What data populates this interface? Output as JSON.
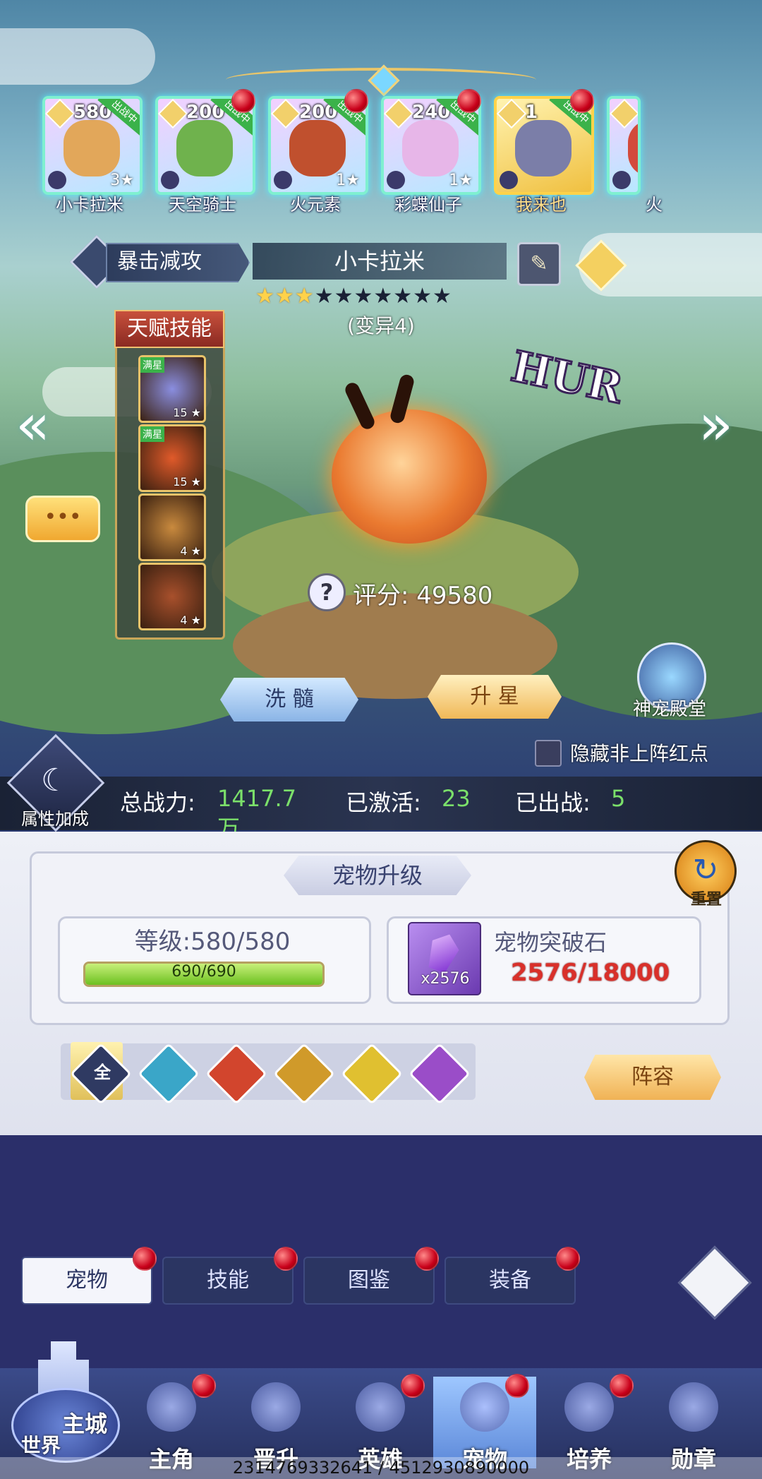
{
  "pets": [
    {
      "name": "小卡拉米",
      "level": "580",
      "status": "出战中",
      "stars": "3",
      "color": "#e2a75a"
    },
    {
      "name": "天空骑士",
      "level": "200",
      "status": "出战中",
      "stars": "",
      "color": "#6fb24d"
    },
    {
      "name": "火元素",
      "level": "200",
      "status": "出战中",
      "stars": "1",
      "color": "#c0502e"
    },
    {
      "name": "彩蝶仙子",
      "level": "240",
      "status": "出战中",
      "stars": "1",
      "color": "#e7b6e8"
    },
    {
      "name": "我来也",
      "level": "1",
      "status": "出战中",
      "stars": "",
      "color": "#7b7ea8"
    },
    {
      "name": "火",
      "level": "",
      "status": "",
      "stars": "",
      "color": "#d34b3c"
    }
  ],
  "header": {
    "skill_label": "暴击减攻",
    "pet_name": "小卡拉米",
    "mutation": "(变异4)",
    "rank": "HUR"
  },
  "talent": {
    "title": "天赋技能",
    "skills": [
      {
        "badge": "满星",
        "level": "15",
        "color": "#8a8ee0"
      },
      {
        "badge": "满星",
        "level": "15",
        "color": "#e05a2a"
      },
      {
        "badge": "",
        "level": "4",
        "color": "#c98a3e"
      },
      {
        "badge": "",
        "level": "4",
        "color": "#a8502c"
      }
    ]
  },
  "score": {
    "label": "评分:",
    "value": "49580"
  },
  "buttons": {
    "wash": "洗 髓",
    "star_up": "升 星",
    "temple": "神宠殿堂",
    "hide_label": "隐藏非上阵红点",
    "attr_bonus": "属性加成"
  },
  "stats": {
    "power_label": "总战力:",
    "power_value": "1417.7",
    "power_unit": "万",
    "active_label": "已激活:",
    "active_value": "23",
    "deployed_label": "已出战:",
    "deployed_value": "5"
  },
  "upgrade": {
    "title": "宠物升级",
    "reset": "重置",
    "level_label": "等级:",
    "level_value": "580/580",
    "exp_text": "690/690",
    "exp_fraction": 1.0,
    "item_name": "宠物突破石",
    "item_count": "x2576",
    "item_progress": "2576/18000"
  },
  "filters": [
    {
      "name": "全",
      "color": "#2f3a62"
    },
    {
      "name": "",
      "color": "#3aa6c8"
    },
    {
      "name": "",
      "color": "#d2452d"
    },
    {
      "name": "",
      "color": "#d09a2a"
    },
    {
      "name": "",
      "color": "#e0c030"
    },
    {
      "name": "",
      "color": "#9a4dc8"
    }
  ],
  "lineup": "阵容",
  "tabs": [
    {
      "label": "宠物"
    },
    {
      "label": "技能"
    },
    {
      "label": "图鉴"
    },
    {
      "label": "装备"
    }
  ],
  "nav": {
    "world": "世界",
    "city": "主城",
    "items": [
      {
        "label": "主角"
      },
      {
        "label": "晋升"
      },
      {
        "label": "英雄"
      },
      {
        "label": "宠物"
      },
      {
        "label": "培养"
      },
      {
        "label": "勋章"
      }
    ]
  },
  "footer": "2314769332641 / 4512930890000"
}
